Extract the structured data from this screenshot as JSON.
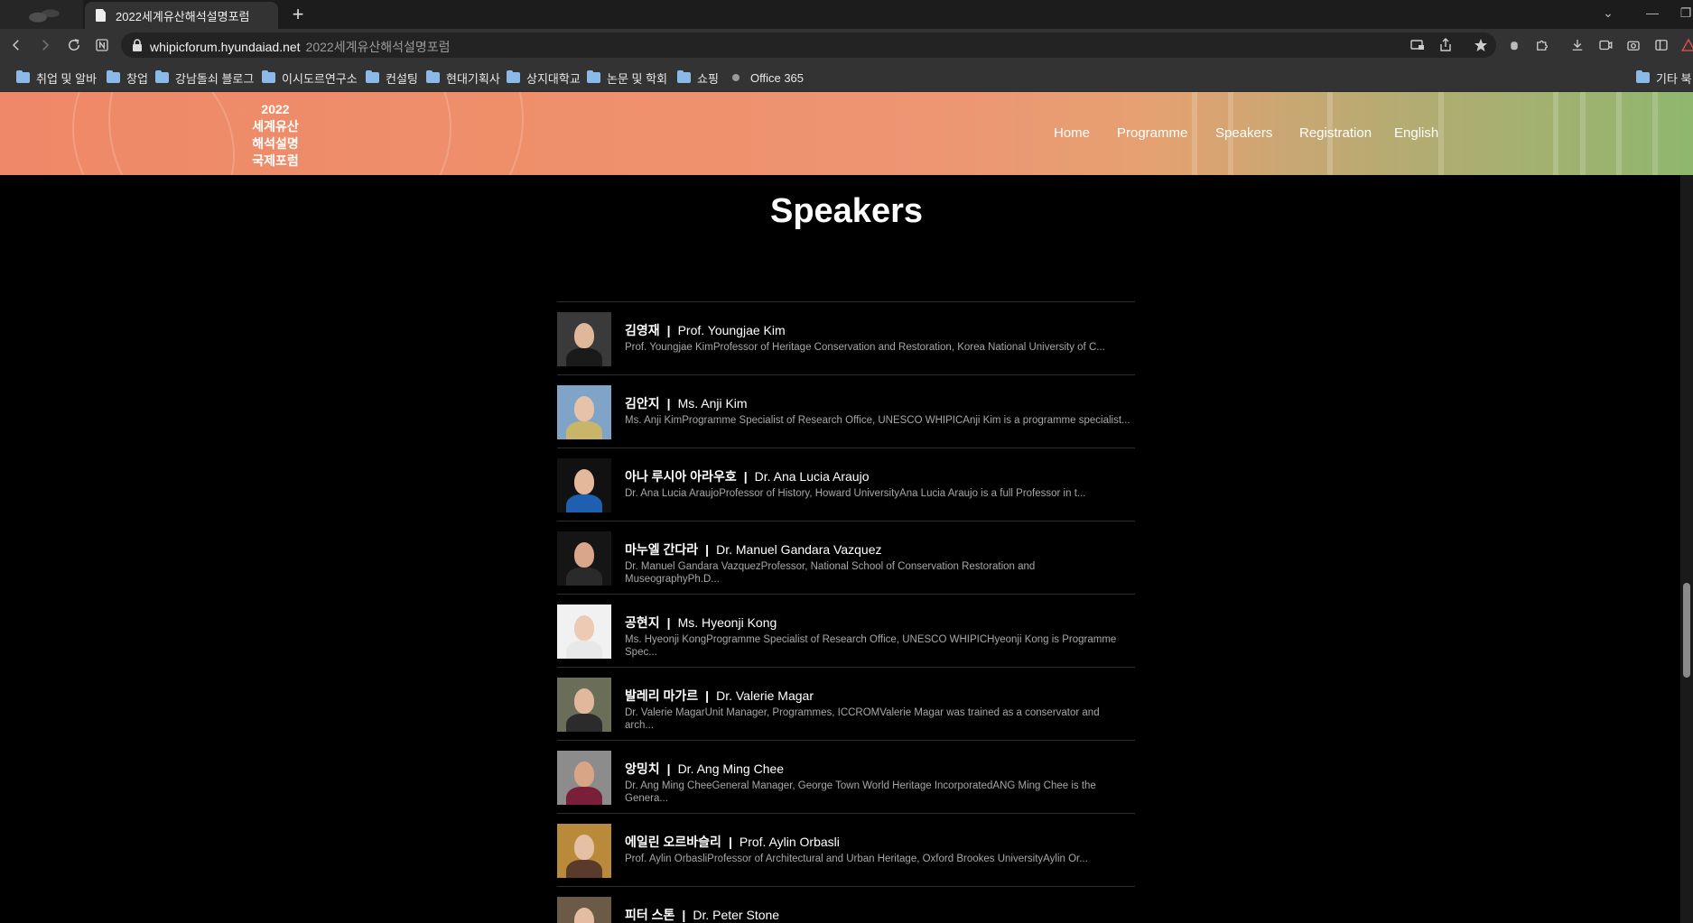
{
  "browser": {
    "tab_title": "2022세계유산해석설명포럼",
    "new_tab_label": "+",
    "url_host": "whipicforum.hyundaiad.net",
    "url_page_title": "2022세계유산해석설명포럼",
    "window_controls": {
      "dropdown": "⌄",
      "minimize": "—",
      "restore": "❐"
    },
    "bookmarks": [
      {
        "label": "취업 및 알바",
        "type": "folder"
      },
      {
        "label": "창업",
        "type": "folder"
      },
      {
        "label": "강남돌쇠 블로그",
        "type": "folder"
      },
      {
        "label": "이시도르연구소",
        "type": "folder"
      },
      {
        "label": "컨설팅",
        "type": "folder"
      },
      {
        "label": "현대기획사",
        "type": "folder"
      },
      {
        "label": "상지대학교",
        "type": "folder"
      },
      {
        "label": "논문 및 학회",
        "type": "folder"
      },
      {
        "label": "쇼핑",
        "type": "folder"
      },
      {
        "label": "Office 365",
        "type": "site"
      }
    ],
    "other_bookmarks": "기타 북"
  },
  "site": {
    "logo_lines": [
      "2022",
      "세계유산",
      "해석설명",
      "국제포럼"
    ],
    "nav": [
      "Home",
      "Programme",
      "Speakers",
      "Registration",
      "English"
    ],
    "page_title": "Speakers"
  },
  "speakers": [
    {
      "name_ko": "김영재",
      "name_en": "Prof. Youngjae Kim",
      "desc": "Prof. Youngjae KimProfessor of Heritage Conservation and Restoration, Korea National University of C...",
      "photo": {
        "bg": "#3a3a3a",
        "face": "#e0b79a",
        "body": "#1a1a1a"
      }
    },
    {
      "name_ko": "김안지",
      "name_en": "Ms. Anji Kim",
      "desc": "Ms. Anji KimProgramme Specialist of Research Office, UNESCO WHIPICAnji Kim is a programme specialist...",
      "photo": {
        "bg": "#7fa4c8",
        "face": "#e6c2a8",
        "body": "#c8b56a"
      }
    },
    {
      "name_ko": "아나 루시아 아라우호",
      "name_en": "Dr. Ana Lucia Araujo",
      "desc": "Dr. Ana Lucia AraujoProfessor of History, Howard UniversityAna Lucia Araujo is a full Professor in t...",
      "photo": {
        "bg": "#111111",
        "face": "#e4b89b",
        "body": "#1f5fb0"
      }
    },
    {
      "name_ko": "마누엘 간다라",
      "name_en": "Dr. Manuel Gandara Vazquez",
      "desc": "Dr. Manuel Gandara VazquezProfessor, National School of Conservation Restoration and MuseographyPh.D...",
      "photo": {
        "bg": "#151515",
        "face": "#d9a68b",
        "body": "#2a2a2a"
      }
    },
    {
      "name_ko": "공현지",
      "name_en": "Ms. Hyeonji Kong",
      "desc": "Ms. Hyeonji KongProgramme Specialist of Research Office, UNESCO WHIPICHyeonji Kong is Programme Spec...",
      "photo": {
        "bg": "#f1f1f1",
        "face": "#eccab3",
        "body": "#e8e8e8"
      }
    },
    {
      "name_ko": "발레리 마가르",
      "name_en": "Dr. Valerie Magar",
      "desc": "Dr. Valerie MagarUnit Manager, Programmes, ICCROMValerie Magar was trained as a conservator and arch...",
      "photo": {
        "bg": "#6a6e58",
        "face": "#e2b89c",
        "body": "#2b2b2b"
      }
    },
    {
      "name_ko": "앙밍치",
      "name_en": "Dr. Ang Ming Chee",
      "desc": "Dr. Ang Ming CheeGeneral Manager, George Town World Heritage IncorporatedANG Ming Chee is the Genera...",
      "photo": {
        "bg": "#8c8c8c",
        "face": "#d8a587",
        "body": "#7a1f3a"
      }
    },
    {
      "name_ko": "에일린 오르바슬리",
      "name_en": "Prof. Aylin Orbasli",
      "desc": "Prof. Aylin OrbasliProfessor of Architectural and Urban Heritage, Oxford Brookes UniversityAylin Or...",
      "photo": {
        "bg": "#b88a3a",
        "face": "#e6c0a4",
        "body": "#5a3a2a"
      }
    },
    {
      "name_ko": "피터 스톤",
      "name_en": "Dr. Peter Stone",
      "desc": "",
      "photo": {
        "bg": "#6b5a45",
        "face": "#e3bca2",
        "body": "#3a3a3a"
      }
    }
  ]
}
